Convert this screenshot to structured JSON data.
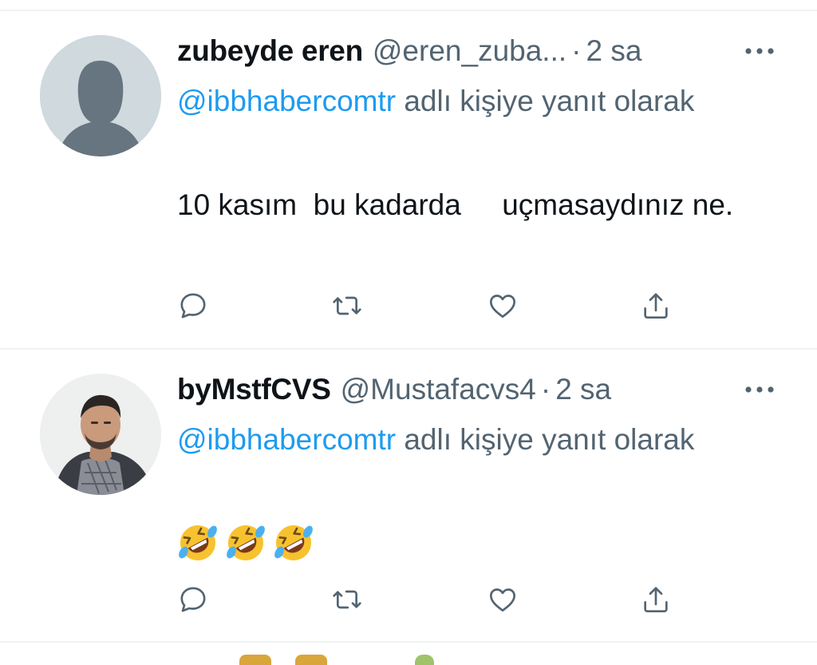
{
  "tweets": [
    {
      "display_name": "zubeyde eren",
      "handle": "@eren_zuba...",
      "separator": "·",
      "time": "2 sa",
      "more_icon": "more-horizontal-icon",
      "avatar": "default-avatar",
      "reply_mention": "@ibbhabercomtr",
      "reply_suffix": " adlı kişiye yanıt olarak",
      "text": "10 kasım  bu kadarda     uçmasaydınız ne.",
      "emojis": []
    },
    {
      "display_name": "byMstfCVS",
      "handle": "@Mustafacvs4",
      "separator": "·",
      "time": "2 sa",
      "more_icon": "more-horizontal-icon",
      "avatar": "profile-photo",
      "reply_mention": "@ibbhabercomtr",
      "reply_suffix": " adlı kişiye yanıt olarak",
      "text": "",
      "emojis": [
        "rolling-on-the-floor-laughing",
        "rolling-on-the-floor-laughing",
        "rolling-on-the-floor-laughing"
      ]
    }
  ],
  "actions": [
    "reply-icon",
    "retweet-icon",
    "like-icon",
    "share-icon"
  ],
  "colors": {
    "accent": "#1d9bf0",
    "secondary_text": "#536471",
    "primary_text": "#0f1419",
    "divider": "#eff3f4"
  }
}
